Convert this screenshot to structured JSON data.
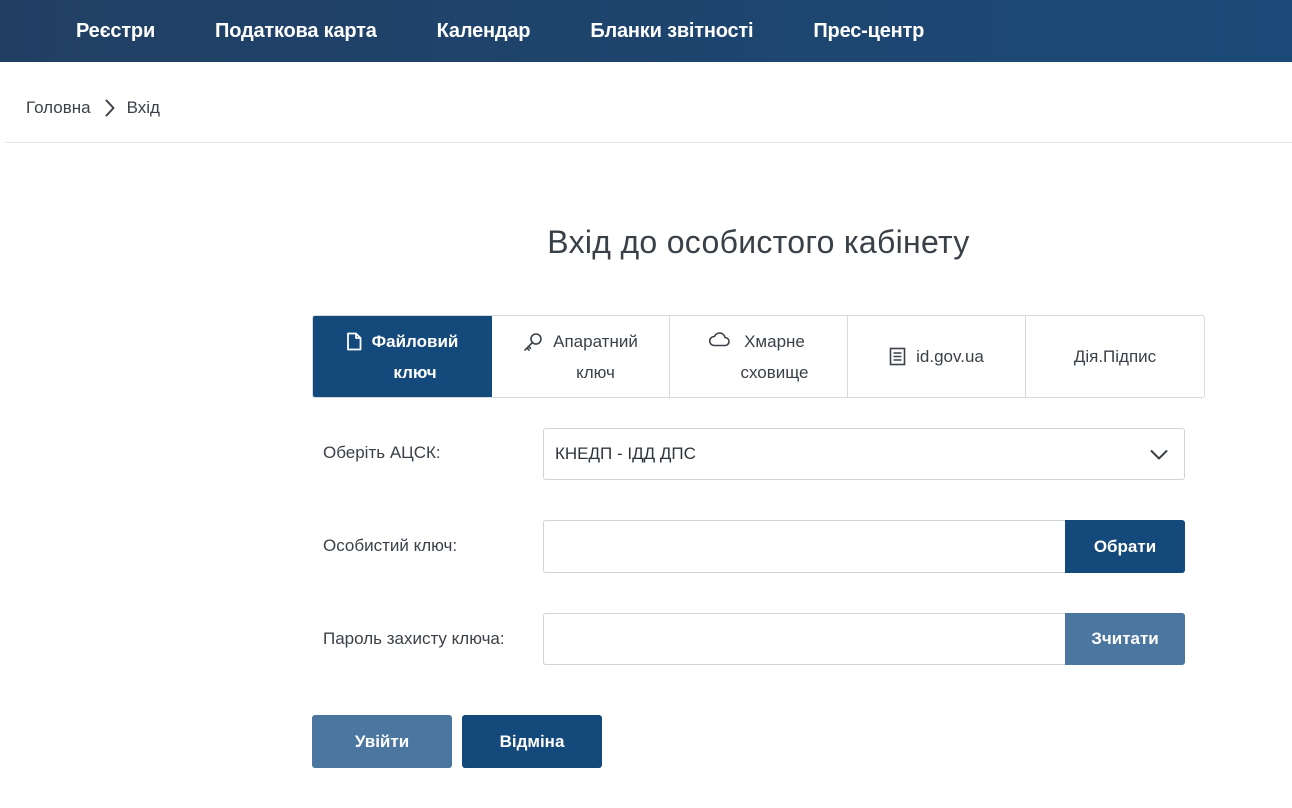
{
  "nav": {
    "items": [
      {
        "label": "Реєстри"
      },
      {
        "label": "Податкова карта"
      },
      {
        "label": "Календар"
      },
      {
        "label": "Бланки звітності"
      },
      {
        "label": "Прес-центр"
      }
    ]
  },
  "breadcrumb": {
    "home": "Головна",
    "current": "Вхід"
  },
  "page": {
    "title": "Вхід до особистого кабінету"
  },
  "tabs": [
    {
      "line1": "Файловий",
      "line2": "ключ",
      "icon": "file-icon",
      "active": true
    },
    {
      "line1": "Апаратний",
      "line2": "ключ",
      "icon": "key-icon",
      "active": false
    },
    {
      "line1": "Хмарне",
      "line2": "сховище",
      "icon": "cloud-icon",
      "active": false
    },
    {
      "line1": "id.gov.ua",
      "icon": "document-icon",
      "active": false
    },
    {
      "line1": "Дія.Підпис",
      "active": false
    }
  ],
  "form": {
    "acsk_label": "Оберіть АЦСК:",
    "acsk_value": "КНЕДП - ІДД ДПС",
    "key_label": "Особистий ключ:",
    "key_value": "",
    "key_button": "Обрати",
    "password_label": "Пароль захисту ключа:",
    "password_value": "",
    "password_button": "Зчитати"
  },
  "actions": {
    "login": "Увійти",
    "cancel": "Відміна"
  },
  "colors": {
    "nav_bg": "#1b4a78",
    "primary": "#14497c",
    "primary_light": "#4a76a0"
  }
}
